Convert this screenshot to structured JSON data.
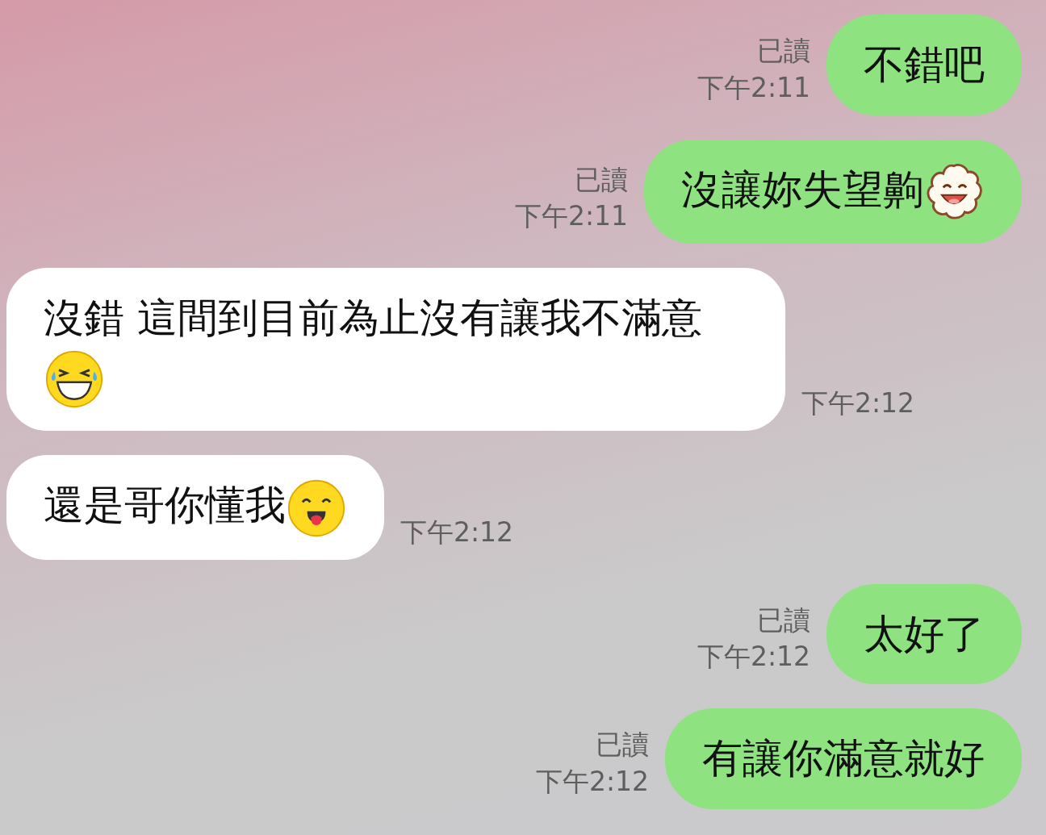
{
  "messages": [
    {
      "kind": "sent",
      "text": "不錯吧",
      "read": "已讀",
      "time": "下午2:11"
    },
    {
      "kind": "sent",
      "text": "沒讓妳失望齁",
      "emoji": {
        "kind": "cloud"
      },
      "read": "已讀",
      "time": "下午2:11"
    },
    {
      "kind": "received",
      "text": "沒錯 這間到目前為止沒有讓我不滿意",
      "emoji": {
        "kind": "laugh"
      },
      "time": "下午2:12"
    },
    {
      "kind": "received",
      "text": "還是哥你懂我",
      "emoji": {
        "kind": "tongue"
      },
      "time": "下午2:12"
    },
    {
      "kind": "sent",
      "text": "太好了",
      "read": "已讀",
      "time": "下午2:12"
    },
    {
      "kind": "sent",
      "text": "有讓你滿意就好",
      "read": "已讀",
      "time": "下午2:12"
    }
  ]
}
